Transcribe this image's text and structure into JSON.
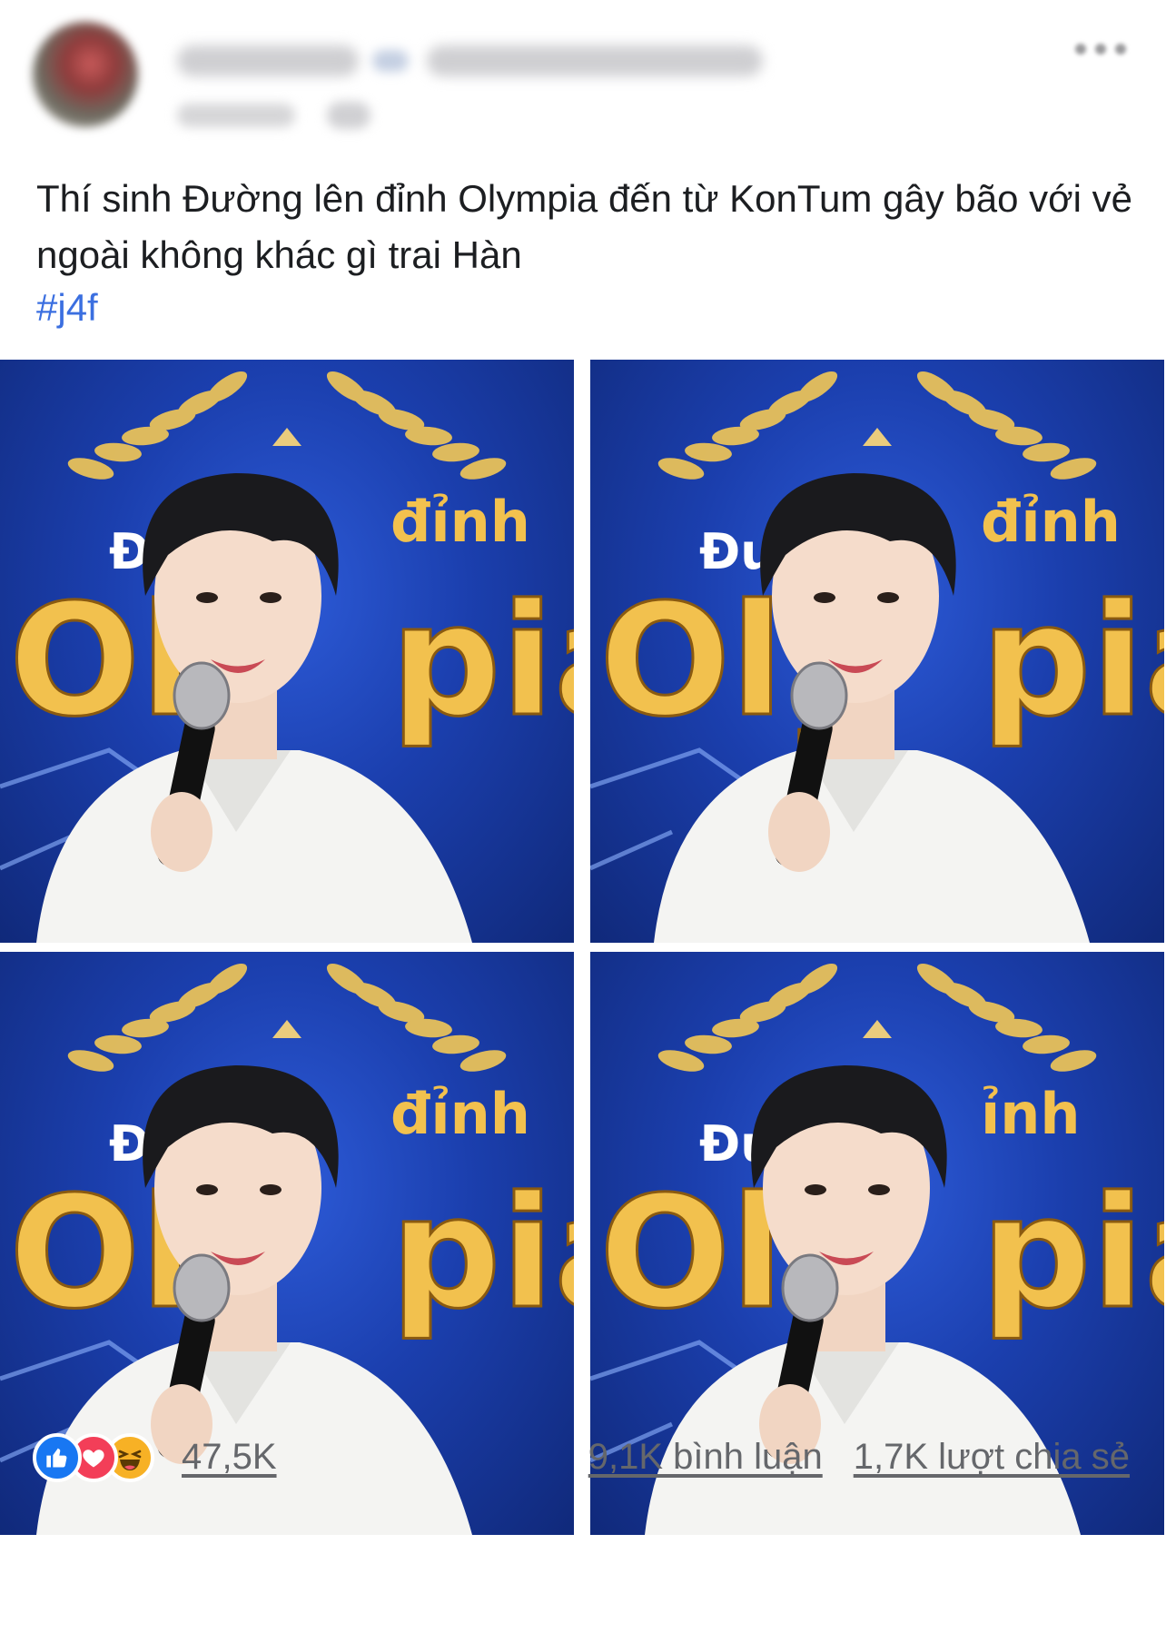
{
  "post": {
    "author": {
      "name": "",
      "group": "",
      "avatar": "avatar"
    },
    "text": "Thí sinh Đường lên đỉnh Olympia đến từ KonTum gây bão với vẻ ngoài không khác gì trai Hàn",
    "hashtag": "#j4f",
    "photos": [
      {
        "watermark_top_left": "Đu",
        "watermark_top_right": "đỉnh",
        "watermark_left": "Oly",
        "watermark_right": "pia"
      },
      {
        "watermark_top_left": "Đu",
        "watermark_top_right": "đỉnh",
        "watermark_left": "Oly",
        "watermark_right": "pia"
      },
      {
        "watermark_top_left": "Đu",
        "watermark_top_right": "đỉnh",
        "watermark_left": "Oly",
        "watermark_right": "pia"
      },
      {
        "watermark_top_left": "Đuờ",
        "watermark_top_right": "ỉnh",
        "watermark_left": "Oly",
        "watermark_right": "pia"
      }
    ]
  },
  "footer": {
    "reactions": [
      "like-icon",
      "love-icon",
      "haha-icon"
    ],
    "reaction_count": "47,5K",
    "comments": "9,1K bình luận",
    "shares": "1,7K lượt chia sẻ"
  },
  "colors": {
    "hashtag": "#3b6fe0",
    "like": "#1877f2",
    "love": "#f33e58",
    "haha": "#f7b125",
    "muted_text": "#65676b",
    "photo_bg": "#1b3fae",
    "watermark_gold": "#f2c14e"
  }
}
